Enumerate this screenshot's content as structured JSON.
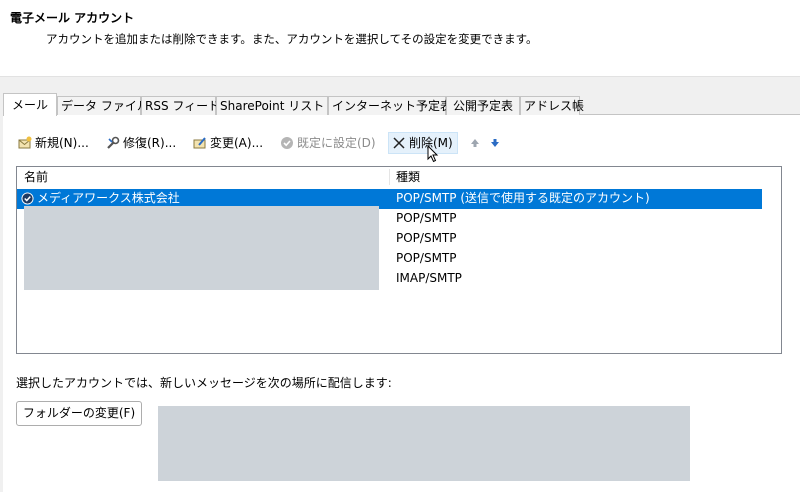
{
  "header": {
    "title": "電子メール アカウント",
    "description": "アカウントを追加または削除できます。また、アカウントを選択してその設定を変更できます。"
  },
  "tabs": [
    {
      "label": "メール",
      "active": true
    },
    {
      "label": "データ ファイル"
    },
    {
      "label": "RSS フィード"
    },
    {
      "label": "SharePoint リスト"
    },
    {
      "label": "インターネット予定表"
    },
    {
      "label": "公開予定表"
    },
    {
      "label": "アドレス帳"
    }
  ],
  "toolbar": {
    "new_label": "新規(N)...",
    "repair_label": "修復(R)...",
    "change_label": "変更(A)...",
    "default_label": "既定に設定(D)",
    "delete_label": "削除(M)"
  },
  "accounts": {
    "col_name": "名前",
    "col_type": "種類",
    "rows": [
      {
        "name": "メディアワークス株式会社",
        "type": "POP/SMTP (送信で使用する既定のアカウント)",
        "selected": true
      },
      {
        "type": "POP/SMTP"
      },
      {
        "type": "POP/SMTP"
      },
      {
        "type": "POP/SMTP"
      },
      {
        "type": "IMAP/SMTP"
      }
    ]
  },
  "delivery": {
    "label": "選択したアカウントでは、新しいメッセージを次の場所に配信します:",
    "folder_button": "フォルダーの変更(F)"
  },
  "colors": {
    "selection": "#0078d7",
    "redaction": "#cdd3d9",
    "hover": "#e5f1fb"
  }
}
